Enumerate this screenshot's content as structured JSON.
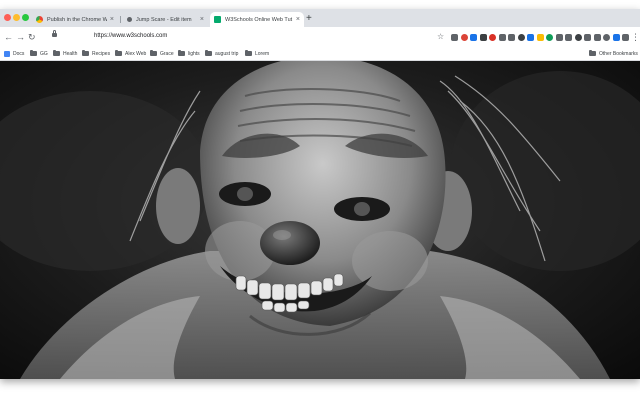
{
  "browser": {
    "tabs": [
      {
        "title": "Publish in the Chrome Web Sto",
        "favicon_color": "#ea4335",
        "active": false
      },
      {
        "title": "Jump Scare - Edit item",
        "favicon_color": "#5f6368",
        "active": false
      },
      {
        "title": "W3Schools Online Web Tut",
        "favicon_color": "#04aa6d",
        "active": true
      }
    ],
    "new_tab_label": "+",
    "close_glyph": "×",
    "back_icon": "←",
    "forward_icon": "→",
    "reload_icon": "↻",
    "url": "https://www.w3schools.com",
    "star_icon": "☆",
    "menu_icon": "⋮",
    "extension_colors": [
      "#5f6368",
      "#db4437",
      "#1a73e8",
      "#3c4043",
      "#d93025",
      "#5f6368",
      "#5f6368",
      "#3c4043",
      "#1a73e8",
      "#fbbc04",
      "#0f9d58",
      "#5f6368",
      "#5f6368",
      "#3c4043",
      "#5f6368",
      "#5f6368",
      "#5f6368",
      "#1a73e8",
      "#5f6368"
    ]
  },
  "bookmarks": {
    "apps_label": "Docs",
    "items": [
      "GG",
      "Health",
      "Recipes",
      "Alex Web",
      "Grace",
      "lights",
      "august trip",
      "Lorem"
    ],
    "other_label": "Other Bookmarks"
  },
  "content": {
    "image_subject": "clown-mask-photo"
  }
}
